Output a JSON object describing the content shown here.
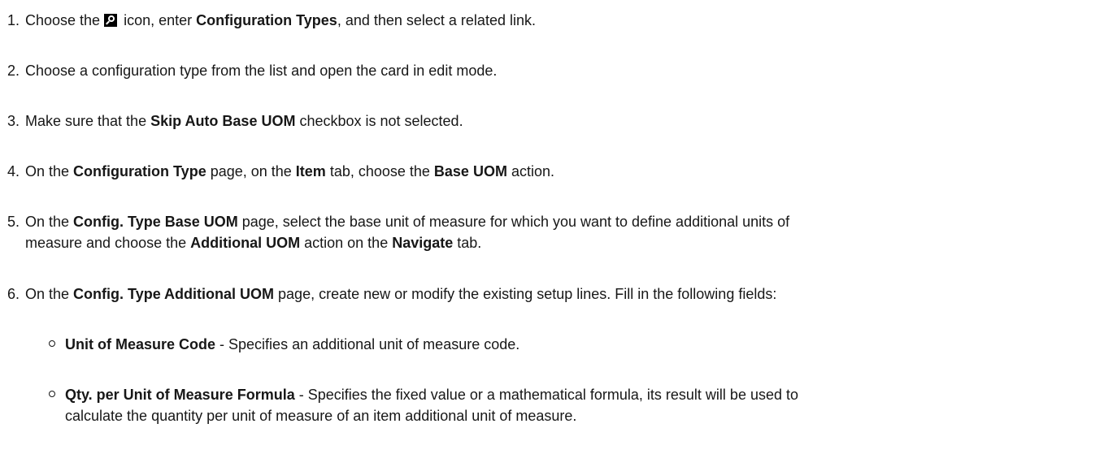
{
  "steps": [
    {
      "num": "1.",
      "t1": "Choose the",
      "t2": " icon, enter ",
      "b1": "Configuration Types",
      "t3": ", and then select a related link."
    },
    {
      "num": "2.",
      "t1": "Choose a configuration type from the list and open the card in edit mode."
    },
    {
      "num": "3.",
      "t1": "Make sure that the ",
      "b1": "Skip Auto Base UOM",
      "t2": " checkbox is not selected."
    },
    {
      "num": "4.",
      "t1": "On the ",
      "b1": "Configuration Type",
      "t2": " page, on the ",
      "b2": "Item",
      "t3": " tab, choose the ",
      "b3": "Base UOM",
      "t4": " action."
    },
    {
      "num": "5.",
      "t1": "On the ",
      "b1": "Config. Type Base UOM",
      "t2": " page, select the base unit of measure for which you want to define additional units of",
      "t3": "measure and choose the ",
      "b2": "Additional UOM",
      "t4": " action on the ",
      "b3": "Navigate",
      "t5": " tab."
    },
    {
      "num": "6.",
      "t1": "On the ",
      "b1": "Config. Type Additional UOM",
      "t2": " page, create new or modify the existing setup lines. Fill in the following fields:"
    }
  ],
  "fields": [
    {
      "name": "Unit of Measure Code",
      "desc": " - Specifies an additional unit of measure code."
    },
    {
      "name": "Qty. per Unit of Measure Formula",
      "desc1": " - Specifies the fixed value or a mathematical formula, its result will be used to",
      "desc2": "calculate the quantity per unit of measure of an item additional unit of measure."
    }
  ]
}
